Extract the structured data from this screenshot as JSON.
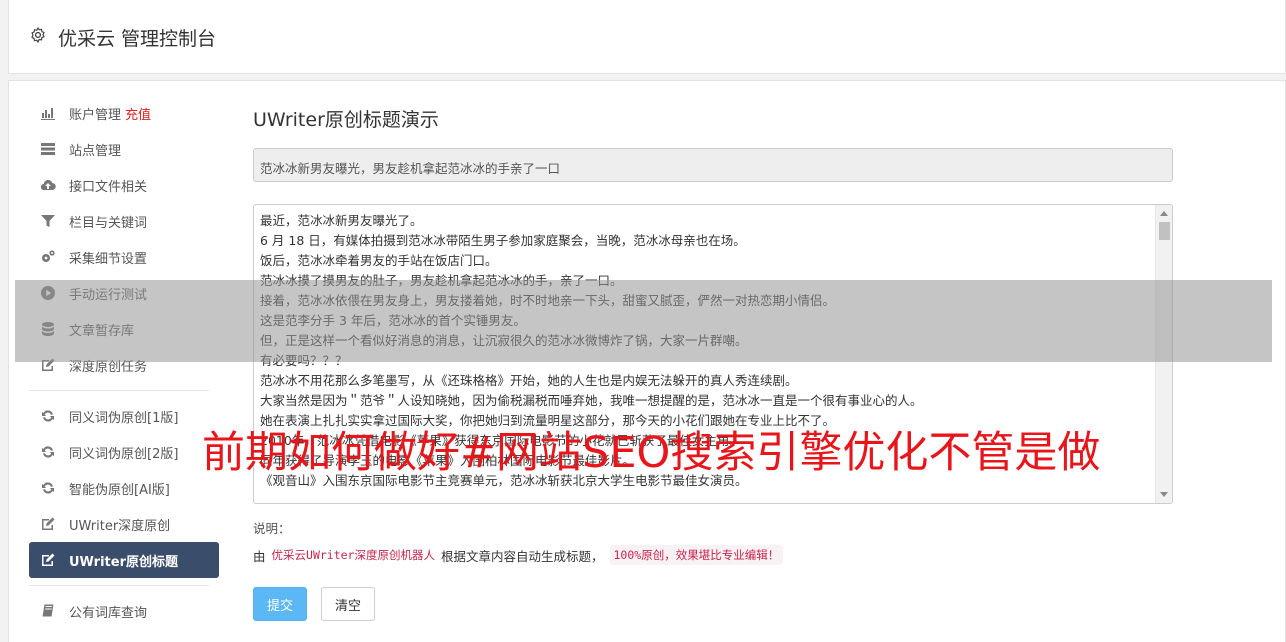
{
  "header": {
    "title": "优采云 管理控制台",
    "icon": "gear-icon"
  },
  "sidebar": {
    "groups": [
      [
        {
          "label": "账户管理",
          "extra": "充值",
          "icon": "bar-chart-icon"
        },
        {
          "label": "站点管理",
          "icon": "server-icon"
        },
        {
          "label": "接口文件相关",
          "icon": "cloud-upload-icon"
        },
        {
          "label": "栏目与关键词",
          "icon": "filter-icon"
        },
        {
          "label": "采集细节设置",
          "icon": "gears-icon"
        },
        {
          "label": "手动运行测试",
          "icon": "play-circle-icon"
        },
        {
          "label": "文章暂存库",
          "icon": "database-icon"
        },
        {
          "label": "深度原创任务",
          "icon": "edit-icon"
        }
      ],
      [
        {
          "label": "同义词伪原创[1版]",
          "icon": "refresh-icon"
        },
        {
          "label": "同义词伪原创[2版]",
          "icon": "refresh-icon"
        },
        {
          "label": "智能伪原创[AI版]",
          "icon": "refresh-icon"
        },
        {
          "label": "UWriter深度原创",
          "icon": "edit-icon"
        },
        {
          "label": "UWriter原创标题",
          "icon": "edit-icon",
          "active": true
        }
      ],
      [
        {
          "label": "公有词库查询",
          "icon": "book-icon"
        }
      ]
    ]
  },
  "main": {
    "page_title": "UWriter原创标题演示",
    "title_value": "范冰冰新男友曝光，男友趁机拿起范冰冰的手亲了一口",
    "article_lines": [
      "最近，范冰冰新男友曝光了。",
      "6 月 18 日，有媒体拍摄到范冰冰带陌生男子参加家庭聚会，当晚，范冰冰母亲也在场。",
      "饭后，范冰冰牵着男友的手站在饭店门口。",
      "范冰冰摸了摸男友的肚子，男友趁机拿起范冰冰的手，亲了一口。",
      "接着，范冰冰依偎在男友身上，男友搂着她，时不时地亲一下头，甜蜜又腻歪，俨然一对热恋期小情侣。",
      "这是范李分手 3 年后，范冰冰的首个实锤男友。",
      "但，正是这样一个看似好消息的消息，让沉寂很久的范冰冰微博炸了锅，大家一片群嘲。",
      "有必要吗？？？",
      "范冰冰不用花那么多笔墨写，从《还珠格格》开始，她的人生也是内娱无法躲开的真人秀连续剧。",
      "大家当然是因为＂范爷＂人设知晓她，因为偷税漏税而唾弃她，我唯一想提醒的是，范冰冰一直是一个很有事业心的人。",
      "她在表演上扎扎实实拿过国际大奖，你把她归到流量明星这部分，那今天的小花们跟她在专业上比不了。",
      "2010年，范冰冰凭借电影《苹果》获得东京国际电影节的小花就已斩获了最佳女主角。",
      "同年获得了导演李玉的电影《苹果》入围柏林国际电影节最佳影片。",
      "《观音山》入围东京国际电影节主竞赛单元，范冰冰斩获北京大学生电影节最佳女演员。"
    ],
    "note_label": "说明：",
    "note_prefix": "由",
    "note_code1": "优采云UWriter深度原创机器人",
    "note_middle": "根据文章内容自动生成标题，",
    "note_code2": "100%原创，效果堪比专业编辑！",
    "submit_label": "提交",
    "clear_label": "清空"
  },
  "overlay": {
    "text": "前期如何做好#网站SEO搜索引擎优化不管是做"
  }
}
